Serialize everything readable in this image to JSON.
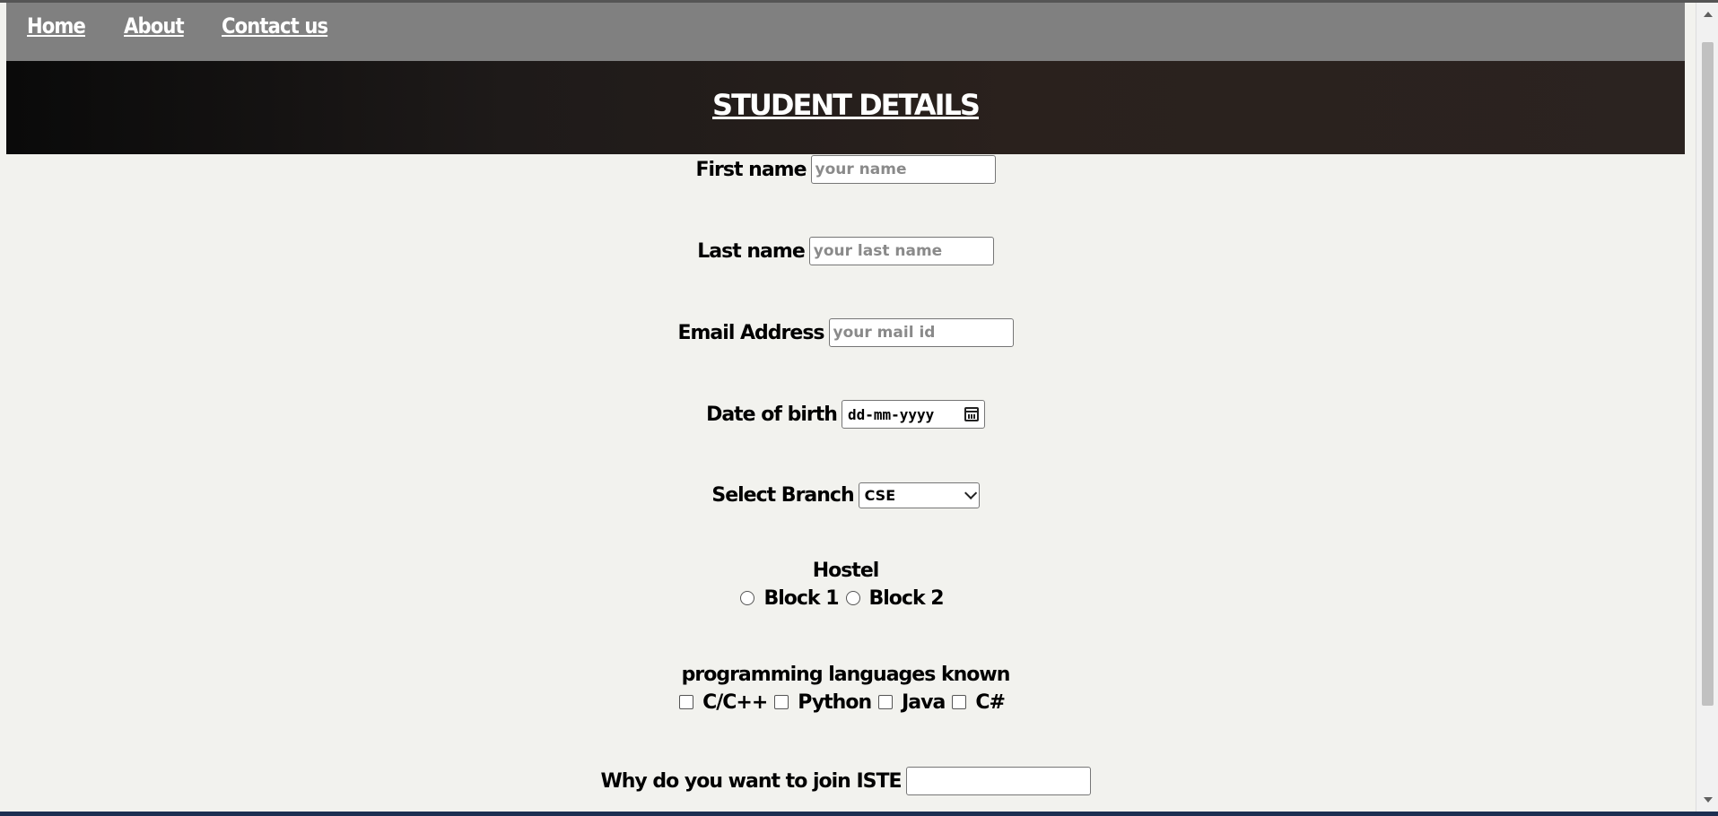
{
  "nav": {
    "links": [
      "Home",
      "About",
      "Contact us"
    ]
  },
  "header": {
    "title": "STUDENT DETAILS"
  },
  "form": {
    "first_name": {
      "label": "First name",
      "placeholder": "your name"
    },
    "last_name": {
      "label": "Last name",
      "placeholder": "your last name"
    },
    "email": {
      "label": "Email Address",
      "placeholder": "your mail id"
    },
    "dob": {
      "label": "Date of birth",
      "value": "dd-mm-yyyy",
      "icon": "calendar-icon"
    },
    "branch": {
      "label": "Select Branch",
      "selected": "CSE"
    },
    "hostel": {
      "label": "Hostel",
      "options": [
        "Block 1",
        "Block 2"
      ]
    },
    "languages": {
      "label": "programming languages known",
      "options": [
        "C/C++",
        "Python",
        "Java",
        "C#"
      ]
    },
    "why_join": {
      "label": "Why do you want to join ISTE",
      "value": ""
    }
  },
  "colors": {
    "navbar": "#808080",
    "header_start": "#0a0a0a",
    "header_end": "#2b2320",
    "background": "#f2f2ee"
  }
}
